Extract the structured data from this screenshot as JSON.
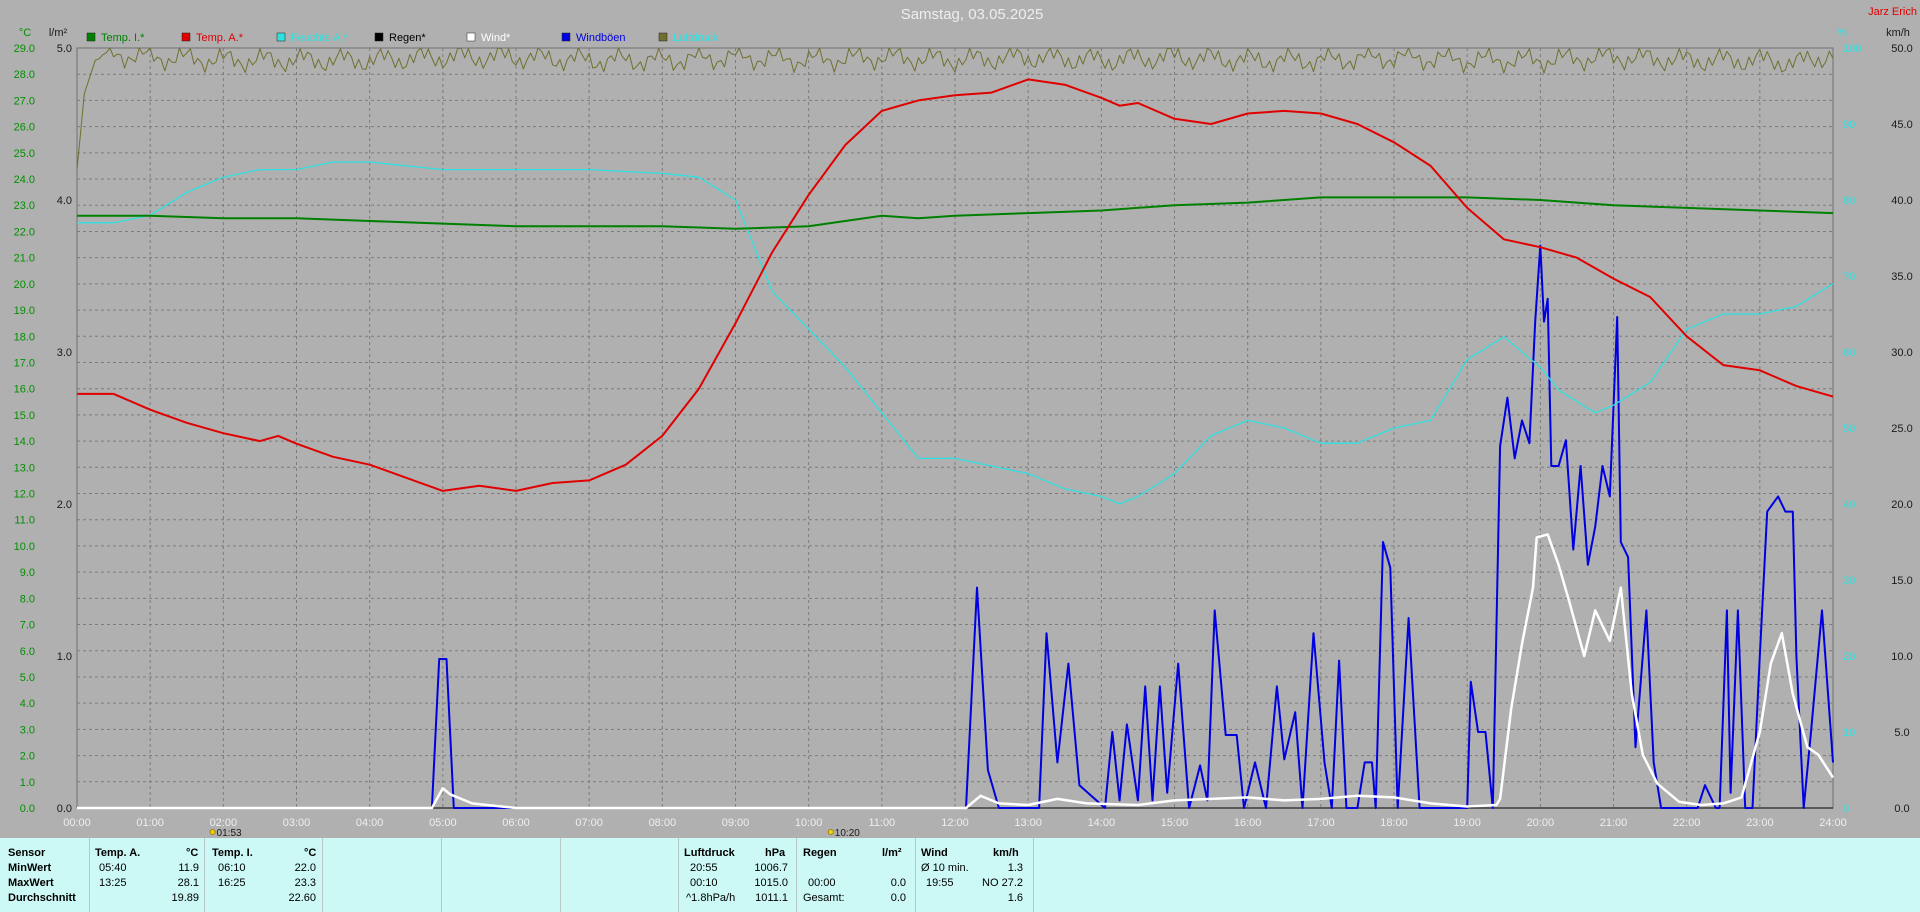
{
  "title": "Samstag, 03.05.2025",
  "station": "Jarz Erich",
  "units": {
    "temp": "°C",
    "rain": "l/m²",
    "humidity": "%",
    "wind": "km/h"
  },
  "legend": [
    {
      "label": "Temp. I.*",
      "color": "#008000",
      "text_color": "#008000"
    },
    {
      "label": "Temp. A.*",
      "color": "#e00000",
      "text_color": "#e00000"
    },
    {
      "label": "Feuchte A.*",
      "color": "#30e0e0",
      "text_color": "#30e0e0"
    },
    {
      "label": "Regen*",
      "color": "#000000",
      "text_color": "#000000"
    },
    {
      "label": "Wind*",
      "color": "#ffffff",
      "text_color": "#ffffff"
    },
    {
      "label": "Windböen",
      "color": "#0000e0",
      "text_color": "#0000e0"
    },
    {
      "label": "Luftdruck",
      "color": "#707030",
      "text_color": "#30e0e0"
    }
  ],
  "sun_markers": [
    {
      "time_h": 1.88,
      "label": "01:53"
    },
    {
      "time_h": 10.33,
      "label": "10:20"
    }
  ],
  "chart_data": {
    "type": "line",
    "x_unit": "hour",
    "xlim": [
      0,
      24
    ],
    "x_ticks": [
      "00:00",
      "01:00",
      "02:00",
      "03:00",
      "04:00",
      "05:00",
      "06:00",
      "07:00",
      "08:00",
      "09:00",
      "10:00",
      "11:00",
      "12:00",
      "13:00",
      "14:00",
      "15:00",
      "16:00",
      "17:00",
      "18:00",
      "19:00",
      "20:00",
      "21:00",
      "22:00",
      "23:00",
      "24:00"
    ],
    "axes": {
      "temp": {
        "range": [
          0,
          29
        ],
        "ticks": [
          "0.0",
          "1.0",
          "2.0",
          "3.0",
          "4.0",
          "5.0",
          "6.0",
          "7.0",
          "8.0",
          "9.0",
          "10.0",
          "11.0",
          "12.0",
          "13.0",
          "14.0",
          "15.0",
          "16.0",
          "17.0",
          "18.0",
          "19.0",
          "20.0",
          "21.0",
          "22.0",
          "23.0",
          "24.0",
          "25.0",
          "26.0",
          "27.0",
          "28.0",
          "29.0"
        ]
      },
      "rain": {
        "range": [
          0,
          5
        ],
        "ticks": [
          "0.0",
          "1.0",
          "2.0",
          "3.0",
          "4.0",
          "5.0"
        ]
      },
      "humidity": {
        "range": [
          0,
          100
        ],
        "ticks": [
          "0",
          "10",
          "20",
          "30",
          "40",
          "50",
          "60",
          "70",
          "80",
          "90",
          "100"
        ]
      },
      "wind": {
        "range": [
          0,
          50
        ],
        "ticks": [
          "0.0",
          "5.0",
          "10.0",
          "15.0",
          "20.0",
          "25.0",
          "30.0",
          "35.0",
          "40.0",
          "45.0",
          "50.0"
        ]
      },
      "pressure": {
        "range": [
          990,
          1015
        ]
      }
    },
    "grid": true,
    "series": [
      {
        "name": "Temp. I.*",
        "axis": "temp",
        "color": "#008000",
        "x": [
          0,
          1,
          2,
          3,
          4,
          5,
          6,
          7,
          8,
          9,
          10,
          11,
          11.5,
          12,
          13,
          14,
          15,
          16,
          17,
          18,
          19,
          20,
          21,
          22,
          23,
          24
        ],
        "y": [
          22.6,
          22.6,
          22.5,
          22.5,
          22.4,
          22.3,
          22.2,
          22.2,
          22.2,
          22.1,
          22.2,
          22.6,
          22.5,
          22.6,
          22.7,
          22.8,
          23.0,
          23.1,
          23.3,
          23.3,
          23.3,
          23.2,
          23.0,
          22.9,
          22.8,
          22.7
        ]
      },
      {
        "name": "Temp. A.*",
        "axis": "temp",
        "color": "#e00000",
        "x": [
          0,
          0.5,
          1,
          1.5,
          2,
          2.5,
          2.75,
          3,
          3.5,
          4,
          4.5,
          5,
          5.5,
          6,
          6.5,
          7,
          7.5,
          8,
          8.5,
          9,
          9.5,
          10,
          10.5,
          11,
          11.5,
          12,
          12.5,
          13,
          13.5,
          14,
          14.25,
          14.5,
          15,
          15.5,
          16,
          16.5,
          17,
          17.5,
          18,
          18.5,
          19,
          19.5,
          20,
          20.5,
          21,
          21.5,
          22,
          22.5,
          23,
          23.5,
          24
        ],
        "y": [
          15.8,
          15.8,
          15.2,
          14.7,
          14.3,
          14.0,
          14.2,
          13.9,
          13.4,
          13.1,
          12.6,
          12.1,
          12.3,
          12.1,
          12.4,
          12.5,
          13.1,
          14.2,
          16.0,
          18.5,
          21.2,
          23.4,
          25.3,
          26.6,
          27.0,
          27.2,
          27.3,
          27.8,
          27.6,
          27.1,
          26.8,
          26.9,
          26.3,
          26.1,
          26.5,
          26.6,
          26.5,
          26.1,
          25.4,
          24.5,
          22.9,
          21.7,
          21.4,
          21.0,
          20.2,
          19.5,
          18.0,
          16.9,
          16.7,
          16.1,
          15.7
        ]
      },
      {
        "name": "Feuchte A.*",
        "axis": "humidity",
        "color": "#30e0e0",
        "x": [
          0,
          0.5,
          1,
          1.5,
          2,
          2.5,
          3,
          3.5,
          4,
          5,
          6,
          7,
          8,
          8.5,
          9,
          9.5,
          10,
          10.5,
          11,
          11.5,
          12,
          12.5,
          13,
          13.5,
          14,
          14.25,
          14.5,
          15,
          15.5,
          16,
          16.5,
          17,
          17.5,
          18,
          18.5,
          19,
          19.5,
          20,
          20.25,
          20.75,
          21,
          21.5,
          22,
          22.5,
          23,
          23.5,
          24
        ],
        "y": [
          77,
          77,
          78,
          81,
          83,
          84,
          84,
          85,
          85,
          84,
          84,
          84,
          83.5,
          83,
          80,
          68,
          63,
          58,
          52,
          46,
          46,
          45,
          44,
          42,
          41,
          40,
          41,
          44,
          49,
          51,
          50,
          48,
          48,
          50,
          51,
          59,
          62,
          58,
          55,
          52,
          53,
          56,
          63,
          65,
          65,
          66,
          69
        ]
      },
      {
        "name": "Regen*",
        "axis": "rain",
        "color": "#000000",
        "x": [
          0,
          24
        ],
        "y": [
          0,
          0
        ]
      },
      {
        "name": "Windböen",
        "axis": "wind",
        "color": "#0000e0",
        "x": [
          0,
          4.85,
          4.95,
          5.05,
          5.15,
          5.25,
          12.15,
          12.3,
          12.45,
          12.6,
          13.15,
          13.25,
          13.4,
          13.55,
          13.7,
          14.05,
          14.15,
          14.25,
          14.35,
          14.5,
          14.6,
          14.7,
          14.8,
          14.9,
          15.05,
          15.2,
          15.35,
          15.45,
          15.55,
          15.7,
          15.85,
          15.95,
          16.1,
          16.25,
          16.4,
          16.5,
          16.65,
          16.75,
          16.9,
          17.05,
          17.15,
          17.25,
          17.35,
          17.5,
          17.6,
          17.7,
          17.75,
          17.85,
          17.95,
          18.05,
          18.2,
          18.35,
          18.5,
          18.7,
          19.0,
          19.05,
          19.15,
          19.25,
          19.35,
          19.45,
          19.55,
          19.65,
          19.75,
          19.85,
          19.93,
          20.0,
          20.05,
          20.1,
          20.15,
          20.25,
          20.35,
          20.45,
          20.55,
          20.65,
          20.75,
          20.85,
          20.95,
          21.05,
          21.1,
          21.2,
          21.3,
          21.45,
          21.55,
          21.65,
          21.75,
          22.0,
          22.15,
          22.25,
          22.4,
          22.45,
          22.55,
          22.6,
          22.7,
          22.8,
          22.9,
          23.0,
          23.1,
          23.25,
          23.35,
          23.45,
          23.5,
          23.6,
          23.7,
          23.85,
          24.0
        ],
        "y": [
          0,
          0,
          9.8,
          9.8,
          0,
          0,
          0,
          14.5,
          2.5,
          0,
          0,
          11.5,
          3.0,
          9.5,
          1.5,
          0,
          5.0,
          0.5,
          5.5,
          0.5,
          8.0,
          0.5,
          8.0,
          1.0,
          9.5,
          0,
          2.8,
          0.5,
          13.0,
          4.8,
          4.8,
          0,
          3.0,
          0,
          8.0,
          3.2,
          6.3,
          0,
          11.5,
          3.0,
          0,
          9.7,
          0,
          0,
          3.0,
          3.0,
          0,
          17.5,
          15.8,
          0,
          12.5,
          0,
          0,
          0,
          0,
          8.3,
          5.0,
          5.0,
          0,
          23.8,
          27.0,
          23.0,
          25.5,
          24.0,
          32.0,
          37.0,
          32.0,
          33.5,
          22.5,
          22.5,
          24.2,
          17.0,
          22.5,
          16.0,
          18.5,
          22.5,
          20.5,
          32.3,
          17.5,
          16.5,
          4.0,
          13.0,
          3.0,
          0,
          0,
          0,
          0,
          1.5,
          0,
          0,
          13.0,
          1.0,
          13.0,
          0,
          0,
          10.0,
          19.5,
          20.5,
          19.5,
          19.5,
          10.0,
          0,
          5.0,
          13.0,
          3.0
        ]
      },
      {
        "name": "Wind*",
        "axis": "wind",
        "color": "#ffffff",
        "x": [
          0,
          4.85,
          5.0,
          5.1,
          5.4,
          5.7,
          6.0,
          6.2,
          12.15,
          12.35,
          12.6,
          13.0,
          13.4,
          13.8,
          14.5,
          15.0,
          15.5,
          16.0,
          16.5,
          17.0,
          17.5,
          18.0,
          18.5,
          19.0,
          19.4,
          19.45,
          19.6,
          19.75,
          19.9,
          19.95,
          20.1,
          20.25,
          20.4,
          20.6,
          20.75,
          20.95,
          21.1,
          21.25,
          21.4,
          21.6,
          21.9,
          22.2,
          22.5,
          22.75,
          23.0,
          23.15,
          23.3,
          23.45,
          23.65,
          23.8,
          24.0
        ],
        "y": [
          0,
          0,
          1.3,
          0.9,
          0.3,
          0.15,
          0,
          0,
          0,
          0.8,
          0.3,
          0.2,
          0.6,
          0.3,
          0.2,
          0.5,
          0.6,
          0.7,
          0.5,
          0.6,
          0.8,
          0.7,
          0.3,
          0.1,
          0.2,
          0.6,
          6.5,
          10.8,
          14.5,
          17.8,
          18.0,
          16.0,
          13.5,
          10.0,
          13.0,
          11.0,
          14.5,
          7.5,
          3.5,
          1.6,
          0.4,
          0.2,
          0.3,
          0.7,
          5.0,
          9.5,
          11.5,
          7.5,
          4.0,
          3.5,
          2.0
        ]
      },
      {
        "name": "Luftdruck",
        "axis": "pressure",
        "color": "#707030",
        "x": [
          0,
          0.1,
          0.25,
          0.5,
          1,
          2,
          3,
          4,
          5,
          6,
          7,
          8,
          9,
          10,
          11,
          12,
          13,
          14,
          15,
          16,
          17,
          18,
          19,
          20,
          21,
          22,
          23,
          23.5,
          24
        ],
        "y": [
          1011,
          1013.5,
          1014.6,
          1014.8,
          1014.7,
          1014.6,
          1014.6,
          1014.6,
          1014.7,
          1014.7,
          1014.6,
          1014.6,
          1014.7,
          1014.6,
          1014.7,
          1014.6,
          1014.7,
          1014.6,
          1014.7,
          1014.6,
          1014.6,
          1014.7,
          1014.6,
          1014.6,
          1014.7,
          1014.6,
          1014.6,
          1014.5,
          1014.8
        ]
      }
    ]
  },
  "table": {
    "col_sensor": {
      "header": "Sensor",
      "rows": [
        "MinWert",
        "MaxWert",
        "Durchschnitt"
      ]
    },
    "temp_a": {
      "header": "Temp. A.",
      "unit": "°C",
      "times": [
        "05:40",
        "13:25",
        ""
      ],
      "values": [
        "11.9",
        "28.1",
        "19.89"
      ]
    },
    "temp_i": {
      "header": "Temp. I.",
      "unit": "°C",
      "times": [
        "06:10",
        "16:25",
        ""
      ],
      "values": [
        "22.0",
        "23.3",
        "22.60"
      ]
    },
    "pressure": {
      "header": "Luftdruck",
      "unit": "hPa",
      "times": [
        "20:55",
        "00:10",
        "^1.8hPa/h"
      ],
      "values": [
        "1006.7",
        "1015.0",
        "1011.1"
      ]
    },
    "rain": {
      "header": "Regen",
      "unit": "l/m²",
      "times": [
        "",
        "00:00",
        "Gesamt:"
      ],
      "values": [
        "",
        "0.0",
        "0.0"
      ]
    },
    "wind": {
      "header": "Wind",
      "unit": "km/h",
      "times": [
        "Ø 10 min.",
        "19:55",
        ""
      ],
      "values": [
        "1.3",
        "NO 27.2",
        "1.6"
      ]
    }
  }
}
